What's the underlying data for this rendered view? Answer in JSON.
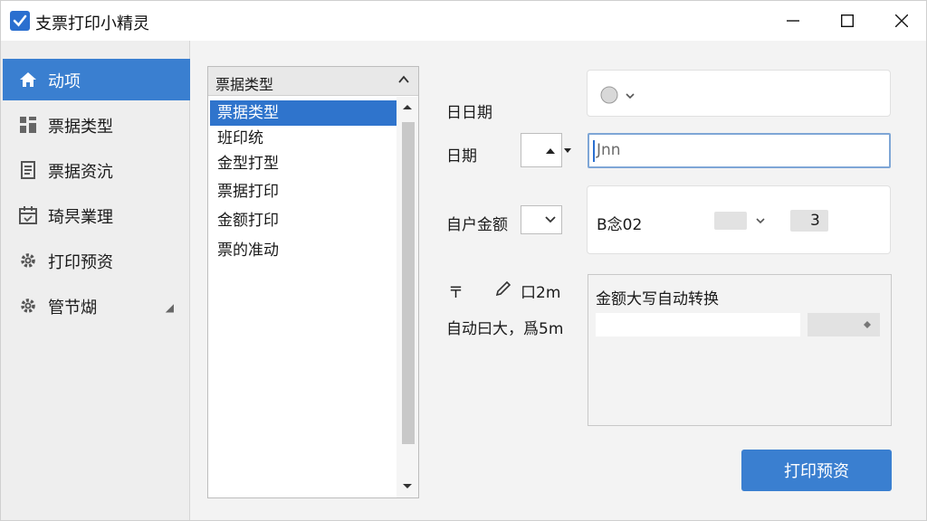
{
  "window": {
    "title": "支票打印小精灵"
  },
  "sidebar": {
    "items": [
      {
        "label": "动项",
        "icon": "home-icon",
        "active": true
      },
      {
        "label": "票据类型",
        "icon": "grid-icon",
        "active": false
      },
      {
        "label": "票据资沆",
        "icon": "document-icon",
        "active": false
      },
      {
        "label": "琦昗業理",
        "icon": "calendar-icon",
        "active": false
      },
      {
        "label": "打印预资",
        "icon": "gear-icon",
        "active": false
      },
      {
        "label": "管节煳",
        "icon": "gear-icon",
        "active": false
      }
    ]
  },
  "list": {
    "header": "票据类型",
    "items": [
      "票据类型",
      "班印统",
      "金型打型",
      "票据打印",
      "金额打印",
      "票的准动"
    ],
    "selected_index": 0
  },
  "form": {
    "label_date1": "日日期",
    "label_date2": "日期",
    "date_input_value": "Jnn",
    "label_amount": "自户金额",
    "amount_value": "B念02",
    "amount_extra": "3",
    "label_row4_sym1": "〒",
    "label_row4_sym2": "口2m",
    "label_row5": "自动曰大，爲5m",
    "convert_title": "金额大写自动转换"
  },
  "actions": {
    "print_preview": "打印预资"
  },
  "colors": {
    "accent": "#3a7fd0",
    "selected": "#2f74cc"
  }
}
